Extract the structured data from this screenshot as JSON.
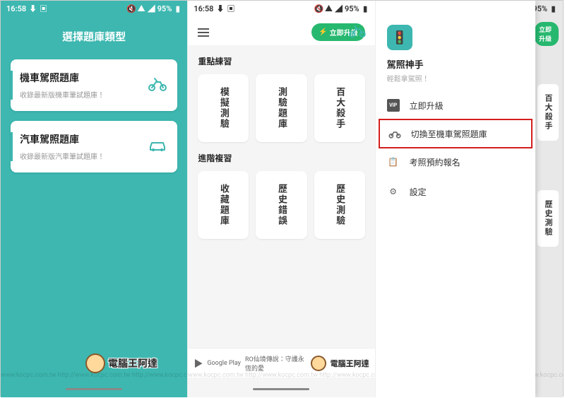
{
  "colors": {
    "primary": "#3db7b0",
    "upgrade": "#27b86f",
    "highlight": "#d41e1e"
  },
  "status": {
    "time": "16:58",
    "battery": "95%"
  },
  "screen1": {
    "title": "選擇題庫類型",
    "cards": [
      {
        "title": "機車駕照題庫",
        "subtitle": "收錄最新版機車筆試題庫！",
        "icon": "motorcycle"
      },
      {
        "title": "汽車駕照題庫",
        "subtitle": "收錄最新版汽車筆試題庫！",
        "icon": "car"
      }
    ]
  },
  "screen2": {
    "upgrade_label": "立即升級",
    "section1": {
      "label": "重點練習",
      "tiles": [
        "模擬測驗",
        "測驗題庫",
        "百大殺手"
      ]
    },
    "section2": {
      "label": "進階複習",
      "tiles": [
        "收藏題庫",
        "歷史錯誤",
        "歷史測驗"
      ]
    },
    "ad": {
      "store": "Google Play",
      "text": "RO仙境傳說：守護永恆的愛"
    }
  },
  "screen3": {
    "app_name": "駕照神手",
    "app_slogan": "輕鬆拿駕照！",
    "upgrade_label": "立即升級",
    "menu": [
      {
        "icon": "vip",
        "label": "立即升級"
      },
      {
        "icon": "motorcycle",
        "label": "切換至機車駕照題庫",
        "highlighted": true
      },
      {
        "icon": "clipboard",
        "label": "考照預約報名"
      },
      {
        "icon": "gear",
        "label": "設定"
      }
    ],
    "bg_tiles": [
      "百大殺手",
      "歷史測驗"
    ]
  },
  "brand": "電腦王阿達",
  "watermark": "http://www.kocpc.com.tw  http://www.kocpc.com.tw  http://www.kocpc.com.tw"
}
